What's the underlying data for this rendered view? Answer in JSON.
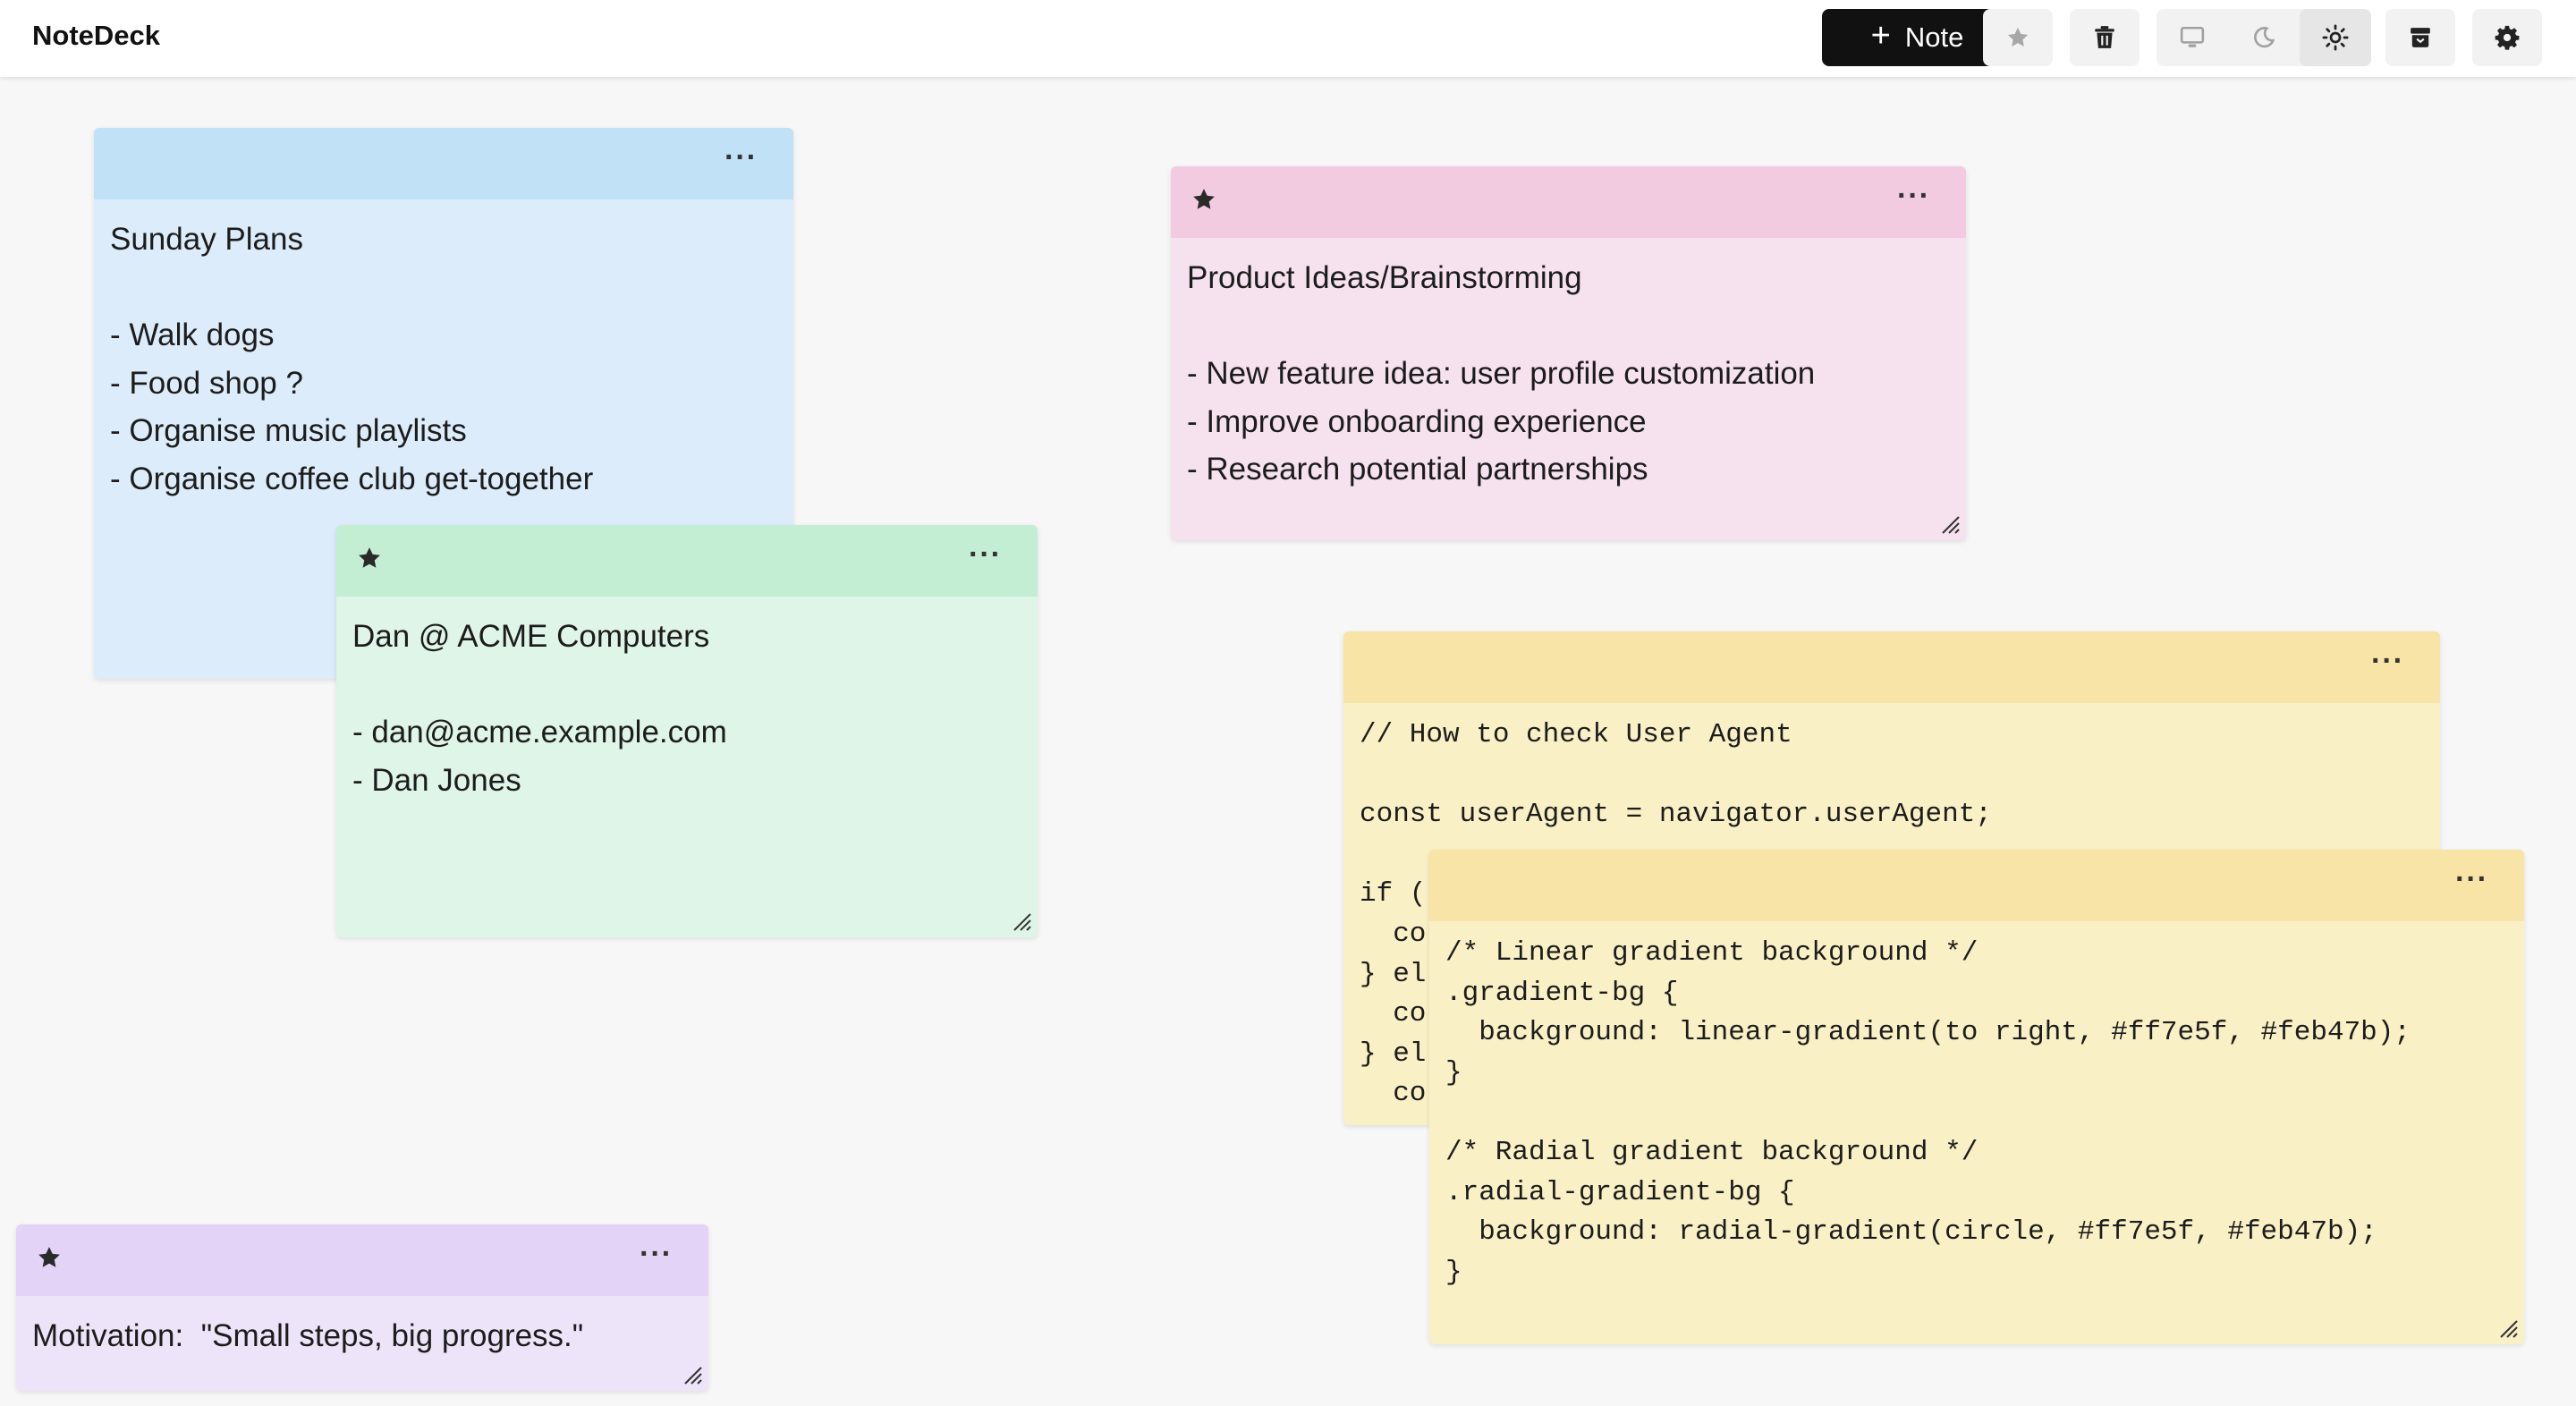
{
  "app": {
    "title": "NoteDeck"
  },
  "toolbar": {
    "new_note_label": "Note",
    "new_note_icon": "plus-icon",
    "buttons": [
      {
        "name": "favorites-button",
        "icon": "star-icon"
      },
      {
        "name": "trash-button",
        "icon": "trash-icon"
      },
      {
        "name": "theme-system-button",
        "icon": "monitor-icon"
      },
      {
        "name": "theme-dark-button",
        "icon": "moon-icon"
      },
      {
        "name": "theme-light-button",
        "icon": "sun-icon",
        "active": true
      },
      {
        "name": "archive-button",
        "icon": "archive-icon"
      },
      {
        "name": "settings-button",
        "icon": "gear-icon"
      }
    ]
  },
  "notes": [
    {
      "id": "sunday-plans",
      "color": "blue",
      "starred": false,
      "menu_label": "···",
      "content": "Sunday Plans\n\n- Walk dogs\n- Food shop ?\n- Organise music playlists\n- Organise coffee club get-together"
    },
    {
      "id": "dan-acme",
      "color": "green",
      "starred": true,
      "menu_label": "···",
      "content": "Dan @ ACME Computers\n\n- dan@acme.example.com\n- Dan Jones"
    },
    {
      "id": "product-ideas",
      "color": "pink",
      "starred": true,
      "menu_label": "···",
      "content": "Product Ideas/Brainstorming\n\n- New feature idea: user profile customization\n- Improve onboarding experience\n- Research potential partnerships"
    },
    {
      "id": "user-agent",
      "color": "yellow",
      "starred": false,
      "menu_label": "···",
      "content": "// How to check User Agent\n\nconst userAgent = navigator.userAgent;\n\nif (\n  co\n} el\n  co\n} el\n  co"
    },
    {
      "id": "gradients",
      "color": "yellow",
      "starred": false,
      "menu_label": "···",
      "content": "/* Linear gradient background */\n.gradient-bg {\n  background: linear-gradient(to right, #ff7e5f, #feb47b);\n}\n\n/* Radial gradient background */\n.radial-gradient-bg {\n  background: radial-gradient(circle, #ff7e5f, #feb47b);\n}"
    },
    {
      "id": "motivation",
      "color": "purple",
      "starred": true,
      "menu_label": "···",
      "content": "Motivation:  \"Small steps, big progress.\""
    }
  ],
  "colors": {
    "blue_body": "#dcecfa",
    "blue_header": "#c1e1f7",
    "green_body": "#dff5e7",
    "green_header": "#c3eed3",
    "pink_body": "#f6e1ee",
    "pink_header": "#f3cbe1",
    "yellow_body": "#faf0c6",
    "yellow_header": "#f8e4a6",
    "purple_body": "#eee4f9",
    "purple_header": "#e3d3f6"
  }
}
